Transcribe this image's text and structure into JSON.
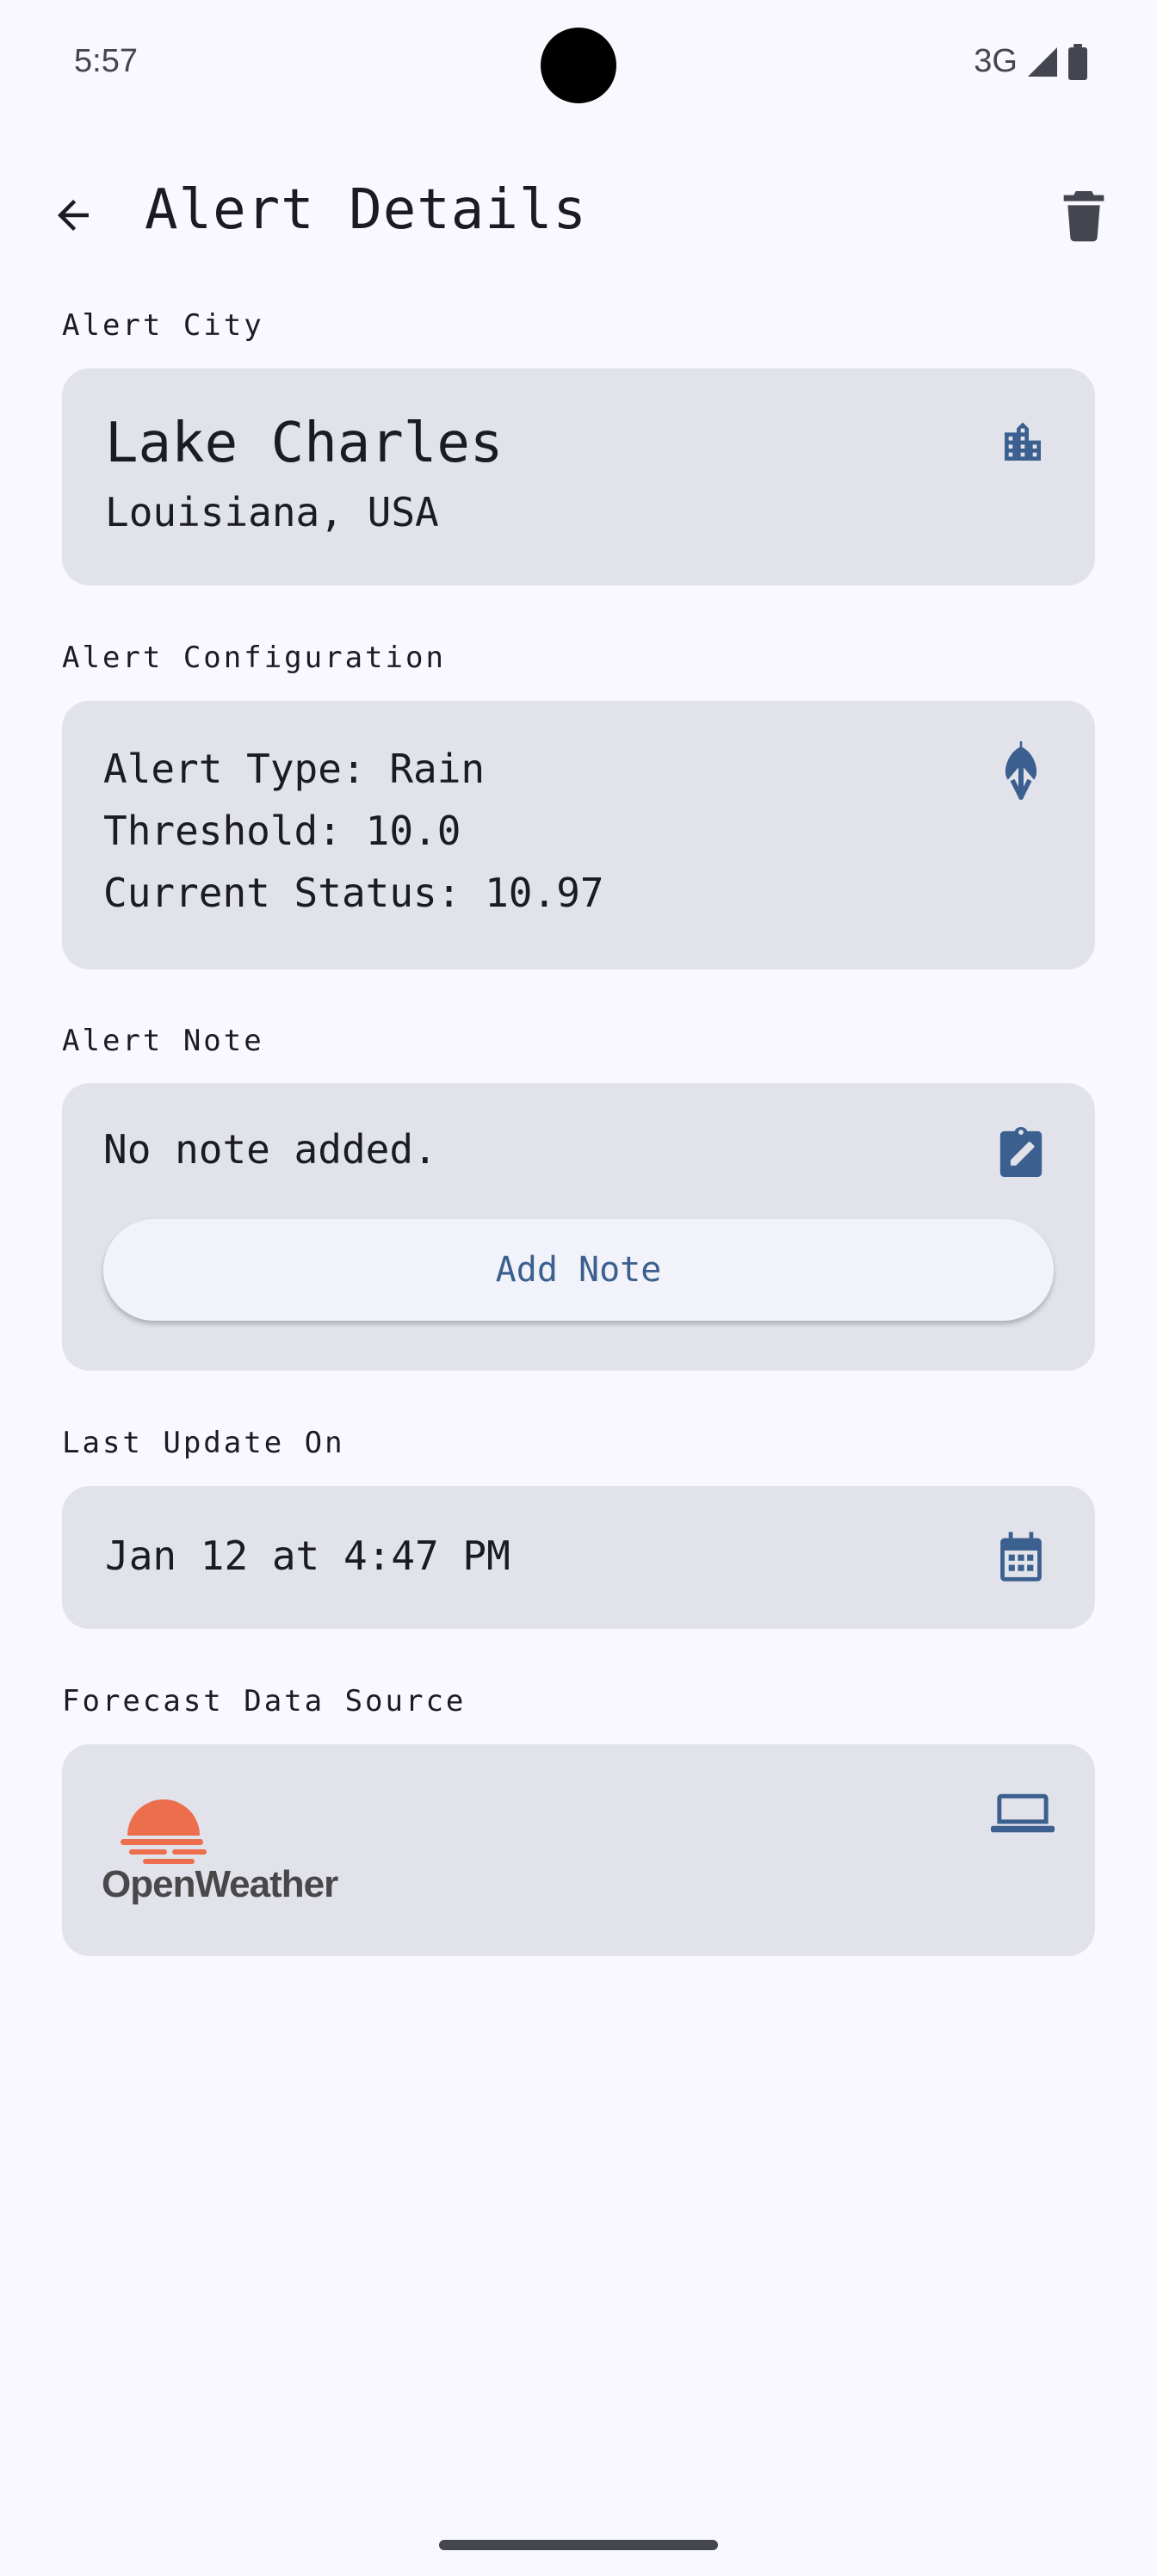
{
  "status_bar": {
    "time": "5:57",
    "network": "3G"
  },
  "app_bar": {
    "title": "Alert Details"
  },
  "city_section": {
    "label": "Alert City",
    "city": "Lake Charles",
    "region": "Louisiana, USA"
  },
  "config_section": {
    "label": "Alert Configuration",
    "lines": [
      "Alert Type: Rain",
      "Threshold: 10.0",
      "Current Status: 10.97"
    ]
  },
  "note_section": {
    "label": "Alert Note",
    "note": "No note added.",
    "button_label": "Add Note"
  },
  "update_section": {
    "label": "Last Update On",
    "value": "Jan 12 at 4:47 PM"
  },
  "source_section": {
    "label": "Forecast Data Source",
    "logo_text": "OpenWeather"
  },
  "icons": {
    "back": "arrow-back-icon",
    "delete": "trash-icon",
    "city": "building-icon",
    "config": "umbrella-icon",
    "note": "edit-note-icon",
    "update": "calendar-icon",
    "source": "laptop-icon"
  },
  "colors": {
    "accent": "#3b5f8e",
    "card": "#e1e2ea",
    "background": "#f8f8fe",
    "brand_orange": "#ec6e4c"
  }
}
